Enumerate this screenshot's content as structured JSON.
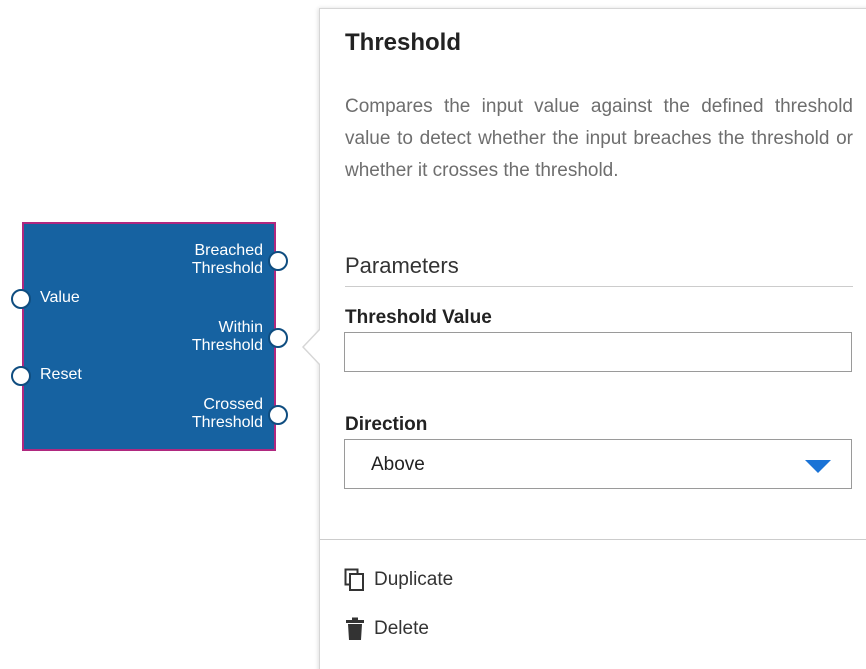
{
  "node": {
    "inputs": [
      {
        "label": "Value"
      },
      {
        "label": "Reset"
      }
    ],
    "outputs": [
      {
        "line1": "Breached",
        "line2": "Threshold"
      },
      {
        "line1": "Within",
        "line2": "Threshold"
      },
      {
        "line1": "Crossed",
        "line2": "Threshold"
      }
    ],
    "colors": {
      "fill": "#1662a1",
      "border": "#b0287f"
    }
  },
  "panel": {
    "title": "Threshold",
    "description": "Compares the input value against the defined threshold value to detect whether the input breaches the threshold or whether it crosses the threshold.",
    "parameters_heading": "Parameters",
    "threshold_value": {
      "label": "Threshold Value",
      "value": "",
      "placeholder": ""
    },
    "direction": {
      "label": "Direction",
      "selected": "Above"
    },
    "actions": {
      "duplicate": {
        "label": "Duplicate",
        "icon": "copy-icon"
      },
      "delete": {
        "label": "Delete",
        "icon": "trash-icon"
      }
    },
    "accent_color": "#1a73d6"
  }
}
